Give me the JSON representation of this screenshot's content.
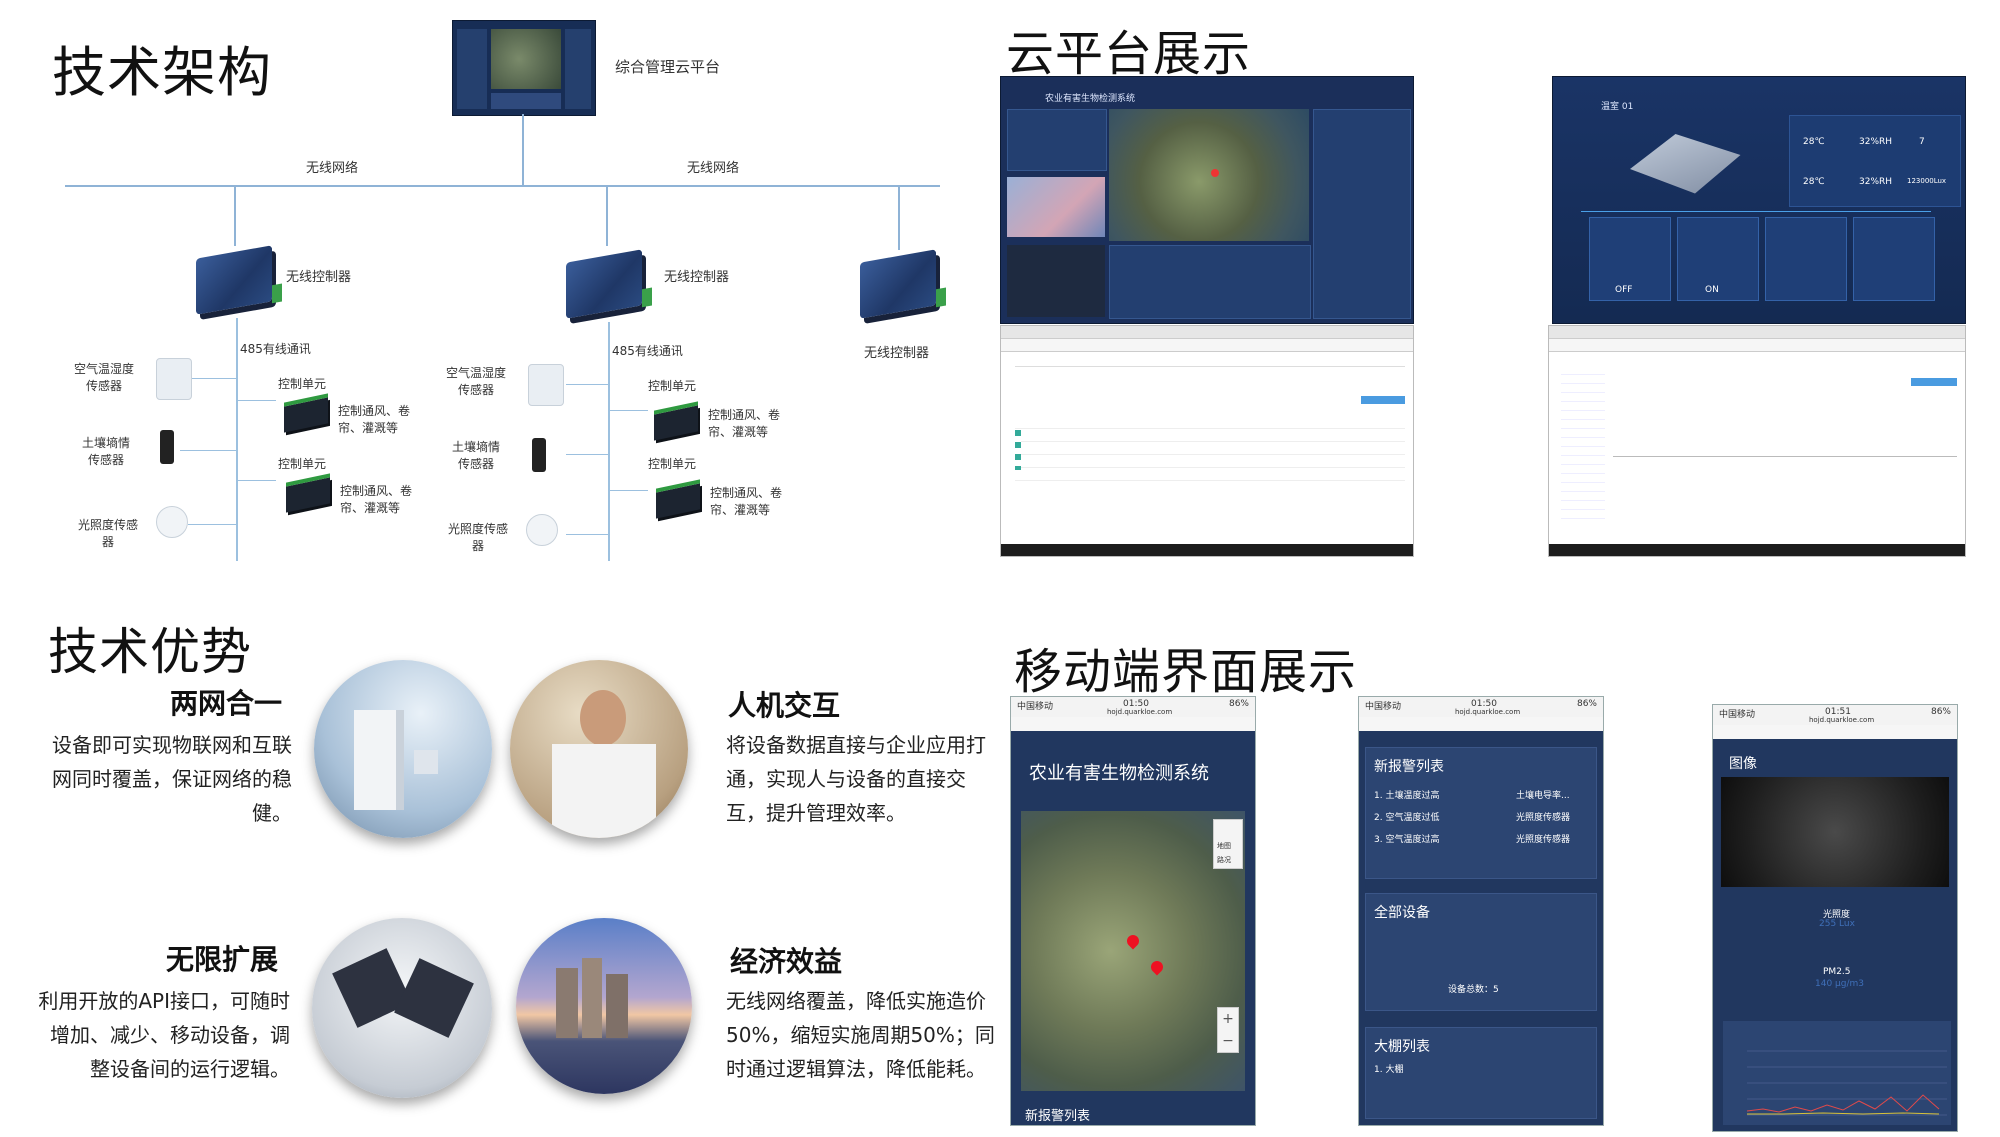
{
  "sections": {
    "arch_title": "技术架构",
    "cloud_title": "云平台展示",
    "adv_title": "技术优势",
    "mobile_title": "移动端界面展示"
  },
  "arch": {
    "platform_label": "综合管理云平台",
    "network_left": "无线网络",
    "network_right": "无线网络",
    "controller1": "无线控制器",
    "controller2": "无线控制器",
    "controller3": "无线控制器",
    "comm1": "485有线通讯",
    "comm2": "485有线通讯",
    "air_sensor": "空气温湿度\n传感器",
    "soil_sensor": "土壤墒情\n传感器",
    "light_sensor": "光照度传感\n器",
    "unit1": "控制单元",
    "unit2": "控制单元",
    "unit_desc": "控制通风、卷\n帘、灌溉等"
  },
  "cloud": {
    "system_name": "农业有害生物检测系统",
    "greenhouse_name": "温室 01",
    "temp1": "28℃",
    "temp2": "28℃",
    "hum1": "32%RH",
    "hum2": "32%RH",
    "count": "7",
    "lux": "123000Lux",
    "btn_off": "OFF",
    "btn_on": "ON"
  },
  "advantages": [
    {
      "title": "两网合一",
      "text": "设备即可实现物联网和互联网同时覆盖，保证网络的稳健。"
    },
    {
      "title": "人机交互",
      "text": "将设备数据直接与企业应用打通，实现人与设备的直接交互，提升管理效率。"
    },
    {
      "title": "无限扩展",
      "text": "利用开放的API接口，可随时增加、减少、移动设备，调整设备间的运行逻辑。"
    },
    {
      "title": "经济效益",
      "text": "无线网络覆盖，降低实施造价50%，缩短实施周期50%；同时通过逻辑算法，降低能耗。"
    }
  ],
  "mobile": {
    "carrier": "中国移动",
    "time1": "01:50",
    "time2": "01:50",
    "time3": "01:51",
    "battery": "86%",
    "url": "hojd.quarkloe.com",
    "phone1_title": "农业有害生物检测系统",
    "phone1_footer": "新报警列表",
    "map_btn1": "地图",
    "map_btn2": "路况",
    "phone2_alarm_title": "新报警列表",
    "alarms": [
      {
        "name": "1. 土壤温度过高",
        "device": "土壤电导率..."
      },
      {
        "name": "2. 空气温度过低",
        "device": "光照度传感器"
      },
      {
        "name": "3. 空气温度过高",
        "device": "光照度传感器"
      }
    ],
    "all_devices": "全部设备",
    "device_total": "设备总数：5",
    "greenhouse_list": "大棚列表",
    "greenhouse_item": "1. 大棚",
    "image_title": "图像",
    "light_label": "光照度",
    "light_value": "255 Lux",
    "pm_label": "PM2.5",
    "pm_value": "140 μg/m3"
  },
  "colors": {
    "line": "#8fb3d6",
    "dark_panel": "#172d55",
    "phone_bg": "#21375f"
  }
}
